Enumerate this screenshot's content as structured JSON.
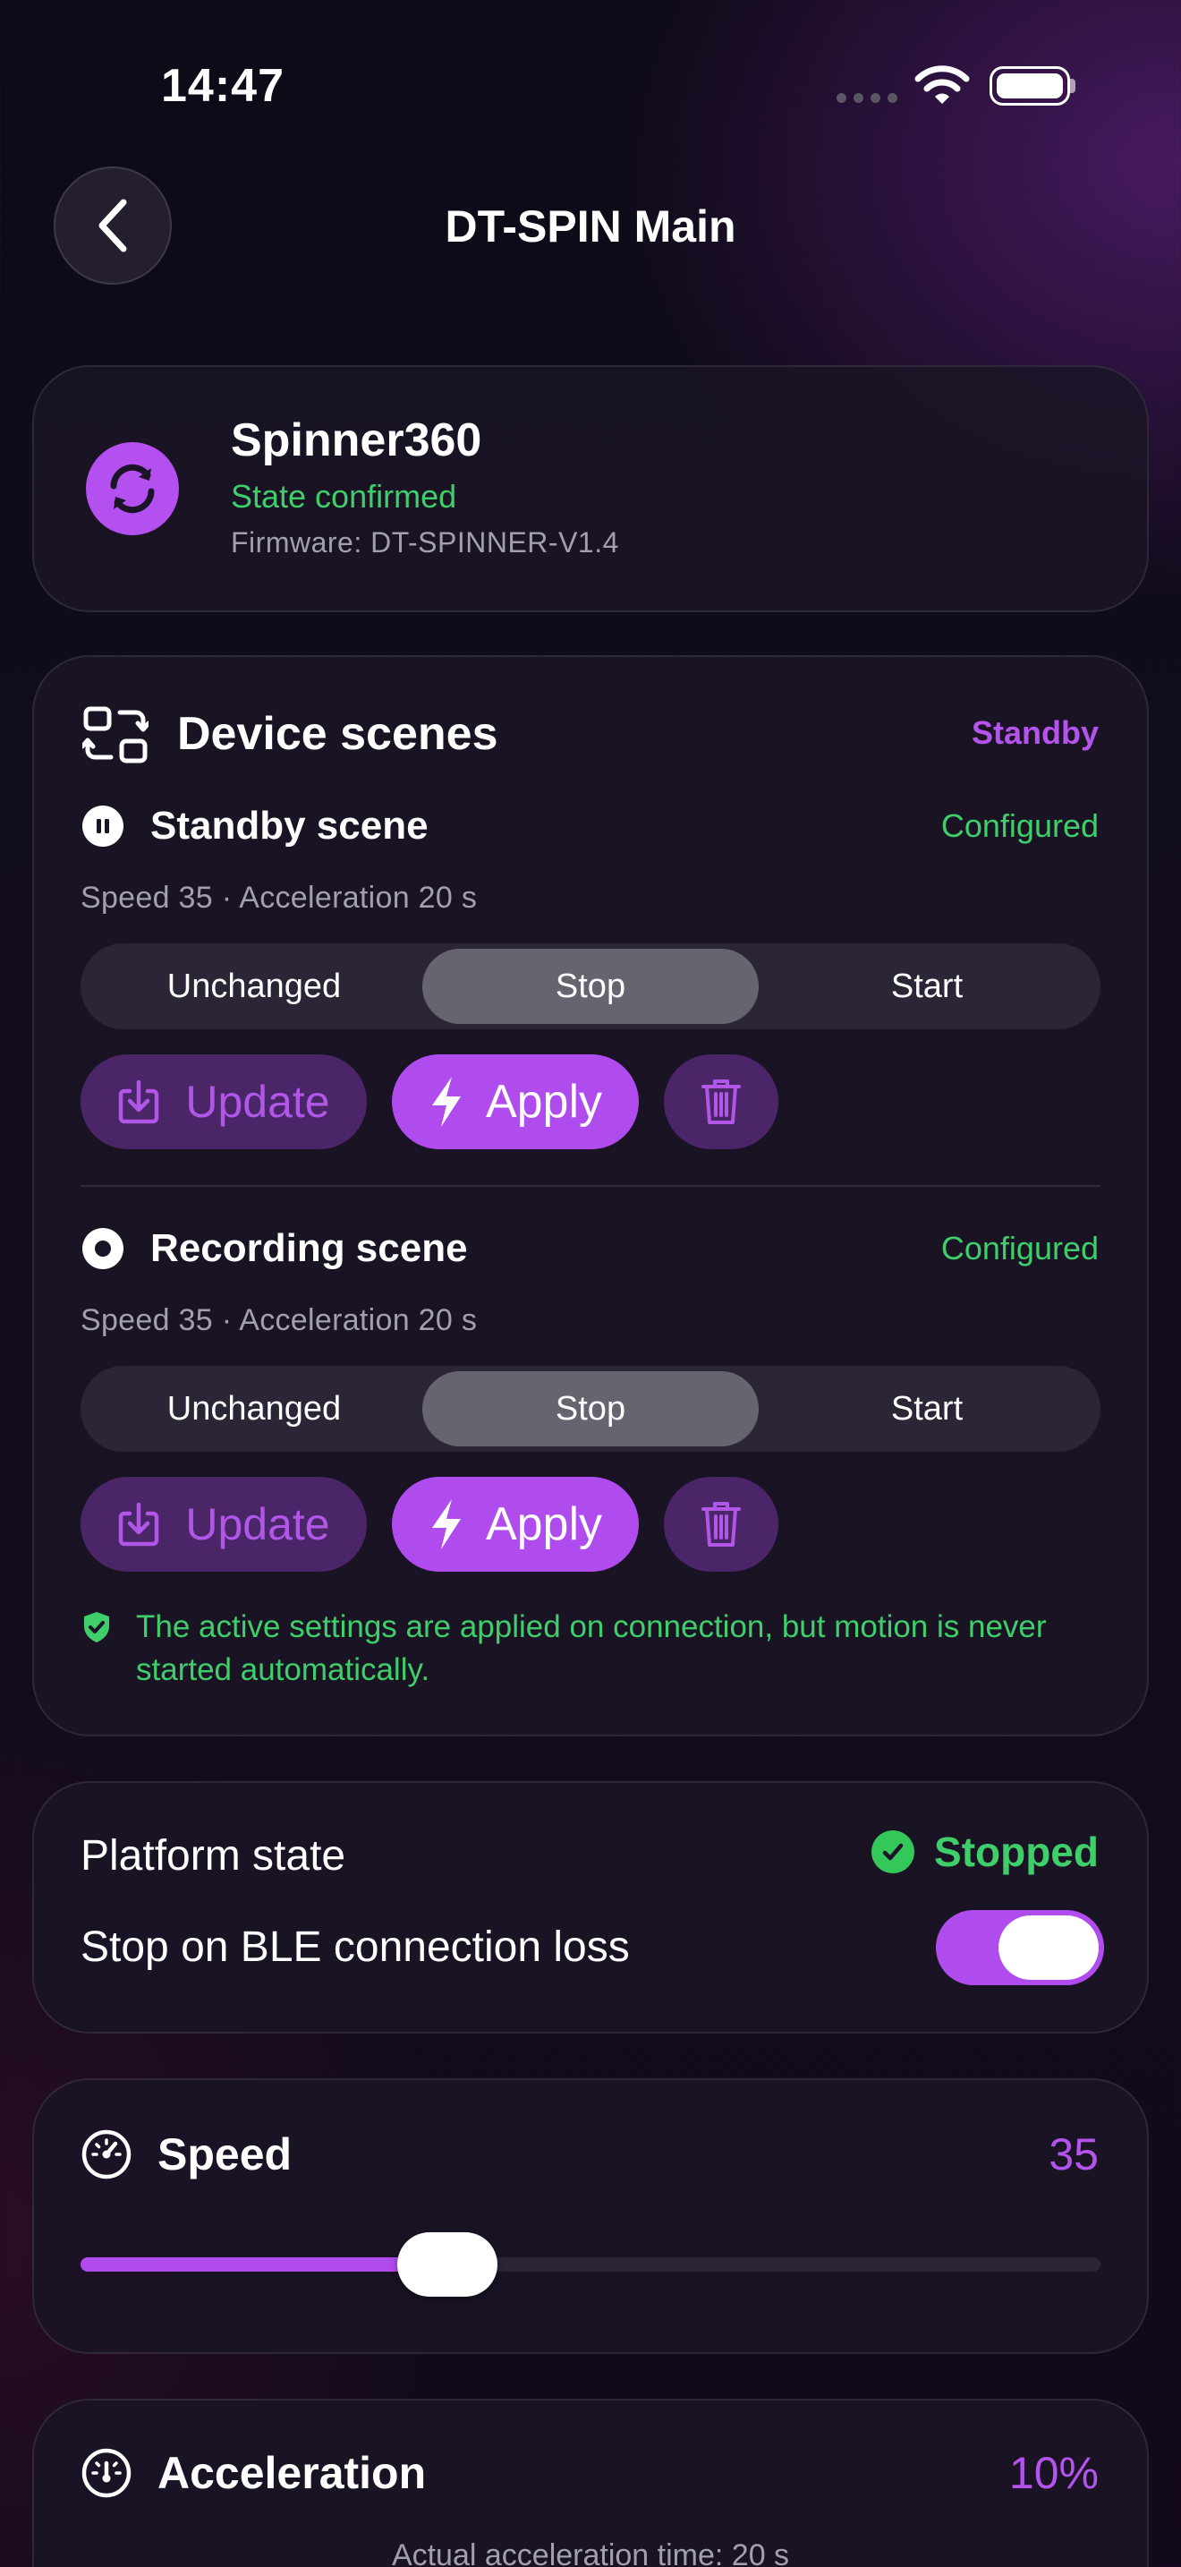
{
  "status_bar": {
    "time": "14:47"
  },
  "header": {
    "title": "DT-SPIN Main"
  },
  "device": {
    "name": "Spinner360",
    "state": "State confirmed",
    "firmware": "Firmware: DT-SPINNER-V1.4"
  },
  "scenes": {
    "title": "Device scenes",
    "status": "Standby",
    "items": [
      {
        "name": "Standby scene",
        "badge": "Configured",
        "meta": "Speed 35 · Acceleration 20 s",
        "options": [
          "Unchanged",
          "Stop",
          "Start"
        ],
        "selected": "Stop",
        "update_label": "Update",
        "apply_label": "Apply"
      },
      {
        "name": "Recording scene",
        "badge": "Configured",
        "meta": "Speed 35 · Acceleration 20 s",
        "options": [
          "Unchanged",
          "Stop",
          "Start"
        ],
        "selected": "Stop",
        "update_label": "Update",
        "apply_label": "Apply"
      }
    ],
    "note": "The active settings are applied on connection, but motion is never started automatically."
  },
  "platform": {
    "state_label": "Platform state",
    "state_value": "Stopped",
    "ble_label": "Stop on BLE connection loss",
    "ble_enabled": true
  },
  "speed": {
    "label": "Speed",
    "value": "35",
    "level": 0.36
  },
  "acceleration": {
    "label": "Acceleration",
    "value": "10%",
    "subtitle": "Actual acceleration time: 20 s"
  },
  "colors": {
    "accent": "#b04bee",
    "success": "#3fcf6a",
    "muted": "#a39fad",
    "card": "#1a1426"
  }
}
